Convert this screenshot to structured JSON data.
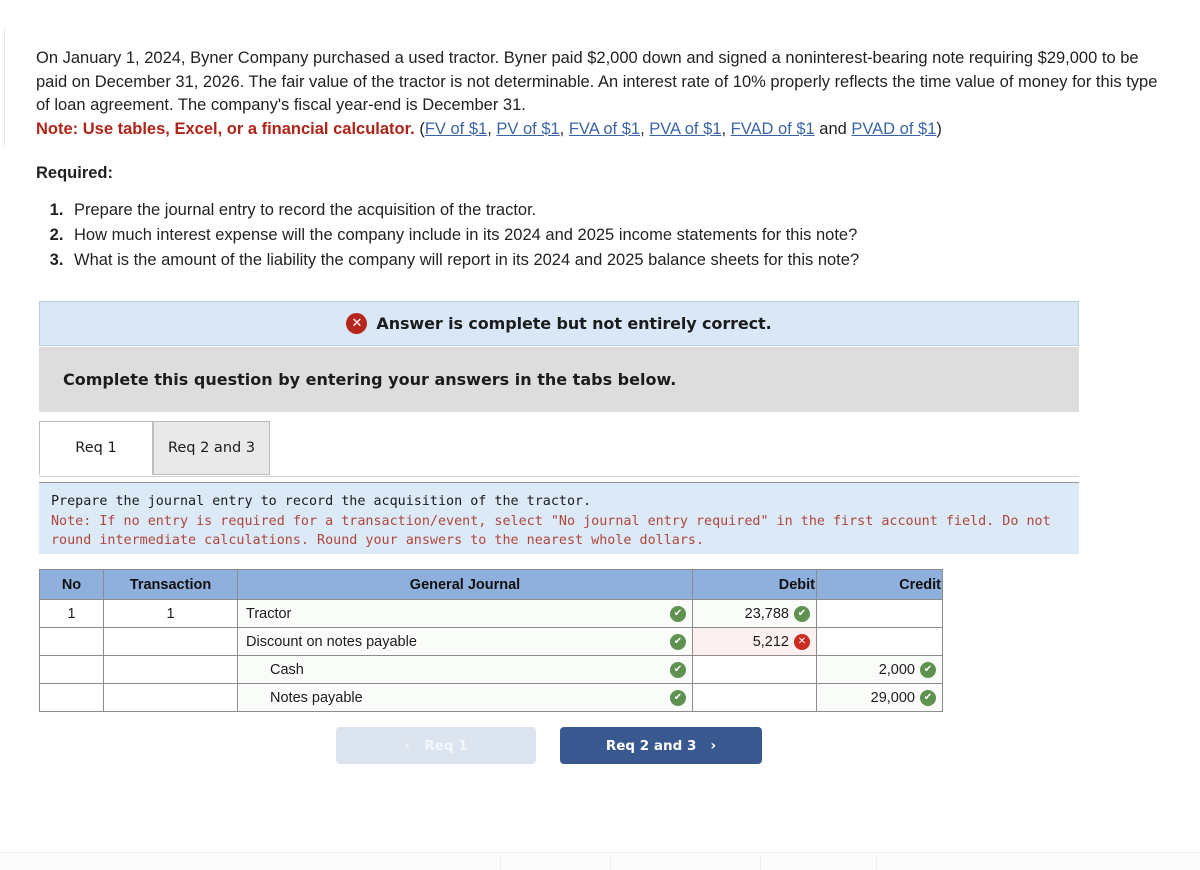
{
  "problem": {
    "paragraph_part1": "On January 1, 2024, Byner Company purchased a used tractor. Byner paid $2,000 down and signed a noninterest-bearing note requiring $29,000 to be paid on December 31, 2026. The fair value of the tractor is not determinable. An interest rate of 10% properly reflects the time value of money for this type of loan agreement. The company's fiscal year-end is December 31.",
    "note_label": "Note: Use tables, Excel, or a financial calculator.",
    "links_open": "(",
    "links": [
      {
        "label": "FV of $1",
        "sep": ", "
      },
      {
        "label": "PV of $1",
        "sep": ", "
      },
      {
        "label": "FVA of $1",
        "sep": ", "
      },
      {
        "label": "PVA of $1",
        "sep": ", "
      },
      {
        "label": "FVAD of $1",
        "sep": " and "
      },
      {
        "label": "PVAD of $1",
        "sep": ""
      }
    ],
    "links_close": ")"
  },
  "required": {
    "heading": "Required:",
    "items": [
      "Prepare the journal entry to record the acquisition of the tractor.",
      "How much interest expense will the company include in its 2024 and 2025 income statements for this note?",
      "What is the amount of the liability the company will report in its 2024 and 2025 balance sheets for this note?"
    ]
  },
  "status": {
    "icon": "x-circle-icon",
    "message": "Answer is complete but not entirely correct.",
    "x_glyph": "✕",
    "complete_text": "Complete this question by entering your answers in the tabs below."
  },
  "tabs": [
    {
      "label": "Req 1",
      "active": true
    },
    {
      "label": "Req 2 and 3",
      "active": false
    }
  ],
  "instruction": {
    "line1": "Prepare the journal entry to record the acquisition of the tractor.",
    "line2": "Note: If no entry is required for a transaction/event, select \"No journal entry required\" in the first account field. Do not round intermediate calculations. Round your answers to the nearest whole dollars."
  },
  "journal": {
    "headers": [
      "No",
      "Transaction",
      "General Journal",
      "Debit",
      "Credit"
    ],
    "rows": [
      {
        "no": "1",
        "transaction": "1",
        "account": "Tractor",
        "indent": false,
        "account_mark": "ok",
        "debit": "23,788",
        "debit_mark": "ok",
        "credit": "",
        "credit_mark": ""
      },
      {
        "no": "",
        "transaction": "",
        "account": "Discount on notes payable",
        "indent": false,
        "account_mark": "ok",
        "debit": "5,212",
        "debit_mark": "bad",
        "credit": "",
        "credit_mark": ""
      },
      {
        "no": "",
        "transaction": "",
        "account": "Cash",
        "indent": true,
        "account_mark": "ok",
        "debit": "",
        "debit_mark": "",
        "credit": "2,000",
        "credit_mark": "ok"
      },
      {
        "no": "",
        "transaction": "",
        "account": "Notes payable",
        "indent": true,
        "account_mark": "ok",
        "debit": "",
        "debit_mark": "",
        "credit": "29,000",
        "credit_mark": "ok"
      }
    ],
    "check_glyph": "✔",
    "x_glyph": "✕"
  },
  "nav": {
    "prev_label": "Req 1",
    "prev_chevron": "‹",
    "next_label": "Req 2 and 3",
    "next_chevron": "›"
  },
  "colors": {
    "banner_bg": "#d9e7f6",
    "header_blue": "#8fb0dc",
    "instr_bg": "#dce9f7",
    "error_red": "#b5261e",
    "ok_green": "#5f9150",
    "next_button": "#38588f"
  }
}
